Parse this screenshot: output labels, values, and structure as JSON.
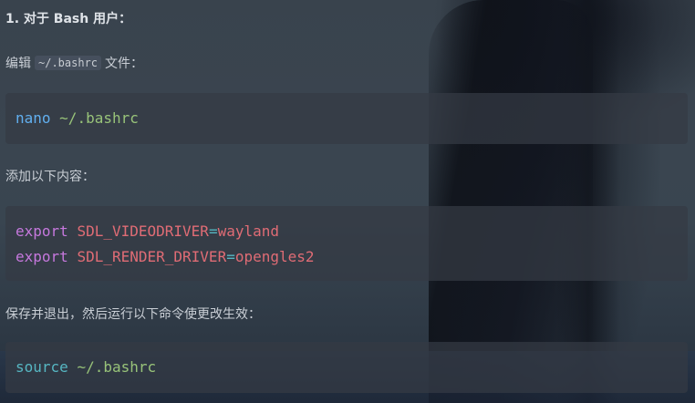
{
  "heading": "1. 对于 Bash 用户：",
  "step1": {
    "prefix": "编辑",
    "file": "~/.bashrc",
    "suffix": "文件："
  },
  "code1": {
    "command": "nano",
    "arg": "~/.bashrc"
  },
  "step2": "添加以下内容：",
  "code2": {
    "lines": [
      {
        "keyword": "export",
        "var": "SDL_VIDEODRIVER",
        "op": "=",
        "value": "wayland"
      },
      {
        "keyword": "export",
        "var": "SDL_RENDER_DRIVER",
        "op": "=",
        "value": "opengles2"
      }
    ]
  },
  "step3": "保存并退出，然后运行以下命令使更改生效：",
  "code3": {
    "command": "source",
    "arg": "~/.bashrc"
  },
  "colors": {
    "command": "#61afef",
    "keyword": "#c678dd",
    "variable": "#e06c75",
    "string": "#98c379",
    "operator": "#56b6c2"
  }
}
